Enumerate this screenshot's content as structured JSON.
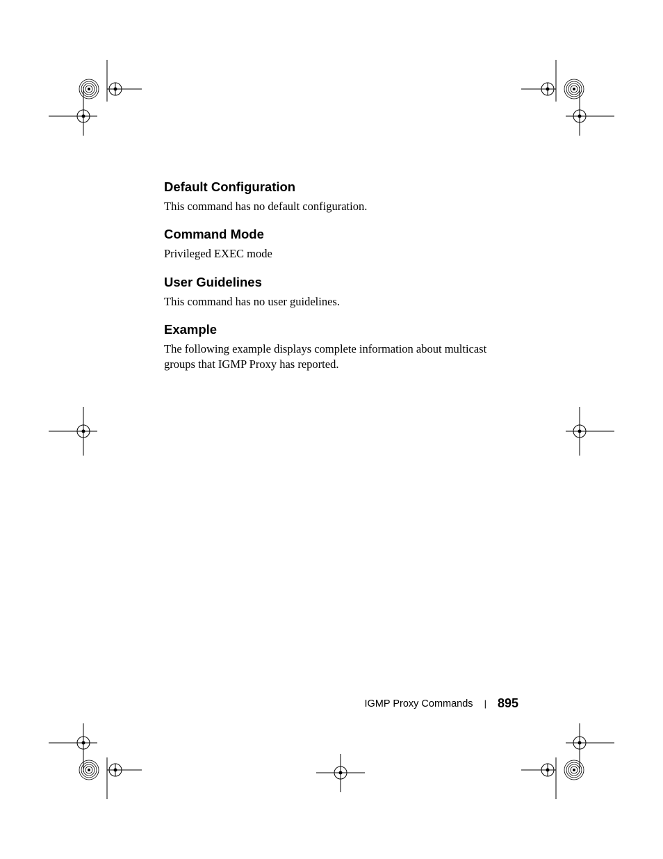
{
  "sections": [
    {
      "heading": "Default Configuration",
      "body": "This command has no default configuration."
    },
    {
      "heading": "Command Mode",
      "body": "Privileged EXEC mode"
    },
    {
      "heading": "User Guidelines",
      "body": "This command has no user guidelines."
    },
    {
      "heading": "Example",
      "body": "The following example displays complete information about multicast groups that IGMP Proxy has reported."
    }
  ],
  "footer": {
    "section": "IGMP Proxy Commands",
    "separator": "|",
    "page": "895"
  }
}
